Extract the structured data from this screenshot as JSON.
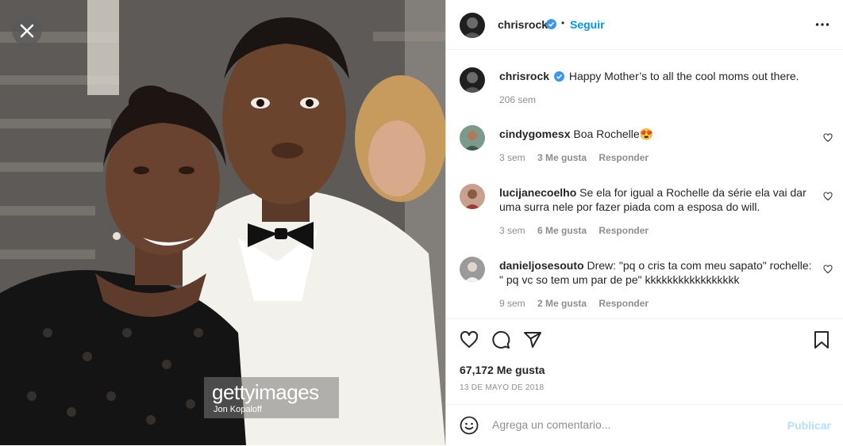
{
  "post": {
    "author": "chrisrock",
    "follow_label": "Seguir",
    "separator": "•",
    "caption": "Happy Mother’s to all the cool moms out there.",
    "caption_age": "206 sem",
    "watermark_brand": "gettyimages",
    "watermark_credit": "Jon Kopaloff"
  },
  "comments": [
    {
      "user": "cindygomesx",
      "text": "Boa Rochelle😍",
      "age": "3 sem",
      "likes": "3 Me gusta",
      "reply": "Responder"
    },
    {
      "user": "lucijanecoelho",
      "text": "Se ela for igual a Rochelle da série ela vai dar uma surra nele por fazer piada com a esposa do will.",
      "age": "3 sem",
      "likes": "6 Me gusta",
      "reply": "Responder"
    },
    {
      "user": "danieljosesouto",
      "text": "Drew: \"pq o cris ta com meu sapato\" rochelle: \" pq vc so tem um par de pe\" kkkkkkkkkkkkkkkkk",
      "age": "9 sem",
      "likes": "2 Me gusta",
      "reply": "Responder"
    }
  ],
  "stats": {
    "likes": "67,172 Me gusta",
    "date": "13 DE MAYO DE 2018"
  },
  "composer": {
    "placeholder": "Agrega un comentario...",
    "publish_label": "Publicar"
  },
  "colors": {
    "link_blue": "#0095f6",
    "publish_disabled": "#b2dffc",
    "verified_blue": "#3897f0",
    "muted_text": "#8e8e8e"
  },
  "icons": [
    "close-icon",
    "verified-badge-icon",
    "more-options-icon",
    "heart-icon",
    "comment-icon",
    "share-icon",
    "bookmark-icon",
    "emoji-icon"
  ]
}
